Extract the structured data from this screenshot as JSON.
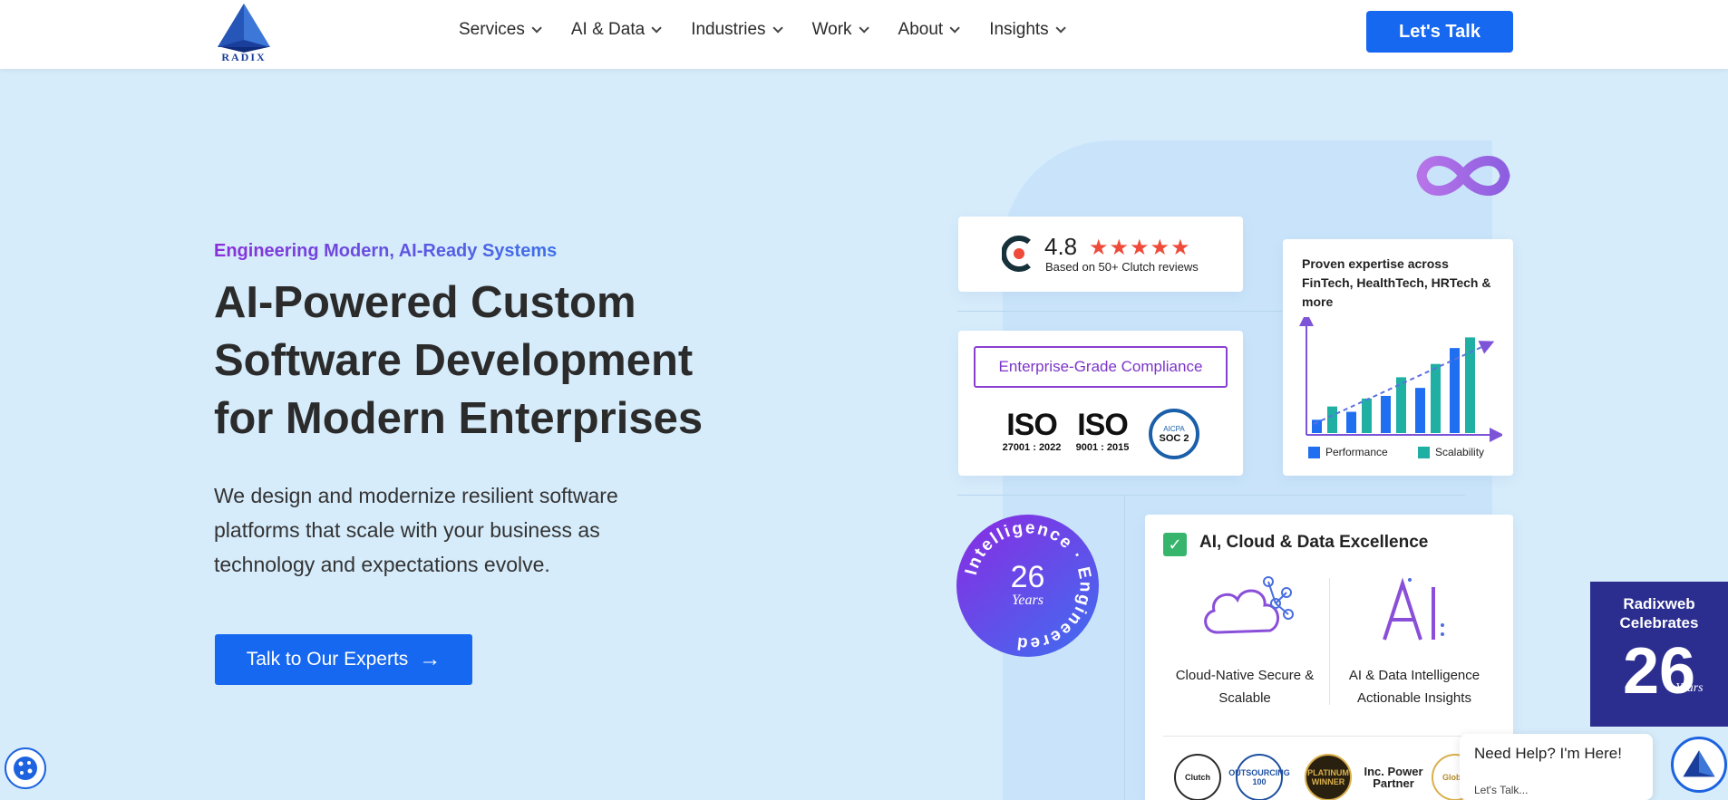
{
  "brand": {
    "name": "RADIX"
  },
  "nav": {
    "items": [
      {
        "label": "Services"
      },
      {
        "label": "AI & Data"
      },
      {
        "label": "Industries"
      },
      {
        "label": "Work"
      },
      {
        "label": "About"
      },
      {
        "label": "Insights"
      }
    ],
    "cta_label": "Let's Talk"
  },
  "hero": {
    "eyebrow": "Engineering Modern, AI-Ready Systems",
    "title_line1": "AI-Powered Custom",
    "title_line2": "Software Development",
    "title_line3": "for Modern Enterprises",
    "desc_line1": "We design and modernize resilient software",
    "desc_line2": "platforms that scale with your business as",
    "desc_line3": "technology and expectations evolve.",
    "button_label": "Talk to Our Experts",
    "button_icon": "arrow-right-icon"
  },
  "clutch": {
    "rating": "4.8",
    "stars": "★★★★★",
    "subtext": "Based on 50+ Clutch reviews"
  },
  "compliance": {
    "title": "Enterprise-Grade Compliance",
    "certs": [
      {
        "name": "ISO",
        "number": "27001 : 2022"
      },
      {
        "name": "ISO",
        "number": "9001 : 2015"
      }
    ],
    "soc": {
      "org": "AICPA",
      "label": "SOC 2"
    }
  },
  "chart_card": {
    "title": "Proven expertise across FinTech, HealthTech, HRTech & more",
    "legend": [
      {
        "name": "Performance",
        "color": "#1f6ff0"
      },
      {
        "name": "Scalability",
        "color": "#1fb0a3"
      }
    ]
  },
  "chart_data": {
    "type": "bar",
    "series": [
      {
        "name": "Performance",
        "values": [
          1,
          1.6,
          2.8,
          3.4,
          6.4
        ]
      },
      {
        "name": "Scalability",
        "values": [
          2,
          2.6,
          4.2,
          5.2,
          7.2
        ]
      }
    ]
  },
  "anniversary_badge": {
    "number": "26",
    "years": "Years",
    "ring_text": "Intelligence · Engineered"
  },
  "ai_card": {
    "title": "AI, Cloud & Data Excellence",
    "feature1_line1": "Cloud-Native Secure &",
    "feature1_line2": "Scalable",
    "feature2_line1": "AI & Data Intelligence",
    "feature2_line2": "Actionable Insights",
    "awards": [
      "Clutch",
      "OUTSOURCING 100",
      "PLATINUM WINNER",
      "Inc. Power Partner",
      "Global"
    ]
  },
  "celebrate": {
    "line1": "Radixweb",
    "line2": "Celebrates",
    "number": "26",
    "years": "Years"
  },
  "chat": {
    "heading": "Need Help? I'm Here!",
    "subtext": "Let's Talk..."
  }
}
